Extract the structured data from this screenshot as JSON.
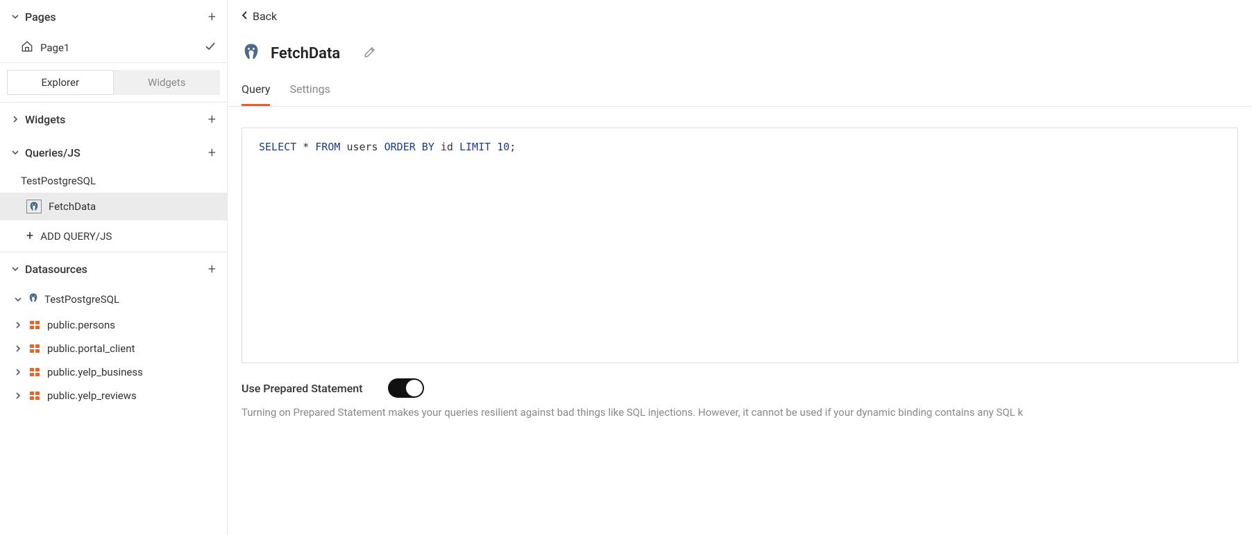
{
  "sidebar": {
    "pages": {
      "label": "Pages",
      "items": [
        {
          "label": "Page1"
        }
      ]
    },
    "toggle": {
      "explorer": "Explorer",
      "widgets": "Widgets"
    },
    "widgets": {
      "label": "Widgets"
    },
    "queries": {
      "label": "Queries/JS",
      "group_label": "TestPostgreSQL",
      "items": [
        {
          "label": "FetchData"
        }
      ],
      "add_label": "ADD QUERY/JS"
    },
    "datasources": {
      "label": "Datasources",
      "items": [
        {
          "label": "TestPostgreSQL",
          "tables": [
            {
              "label": "public.persons"
            },
            {
              "label": "public.portal_client"
            },
            {
              "label": "public.yelp_business"
            },
            {
              "label": "public.yelp_reviews"
            }
          ]
        }
      ]
    }
  },
  "main": {
    "back_label": "Back",
    "title": "FetchData",
    "tabs": {
      "query": "Query",
      "settings": "Settings"
    },
    "sql": {
      "select": "SELECT",
      "star": "*",
      "from": "FROM",
      "table": "users",
      "orderby": "ORDER BY",
      "col": "id",
      "limit": "LIMIT",
      "n": "10",
      "semi": ";"
    },
    "prepared": {
      "label": "Use Prepared Statement",
      "description": "Turning on Prepared Statement makes your queries resilient against bad things like SQL injections. However, it cannot be used if your dynamic binding contains any SQL k"
    }
  }
}
